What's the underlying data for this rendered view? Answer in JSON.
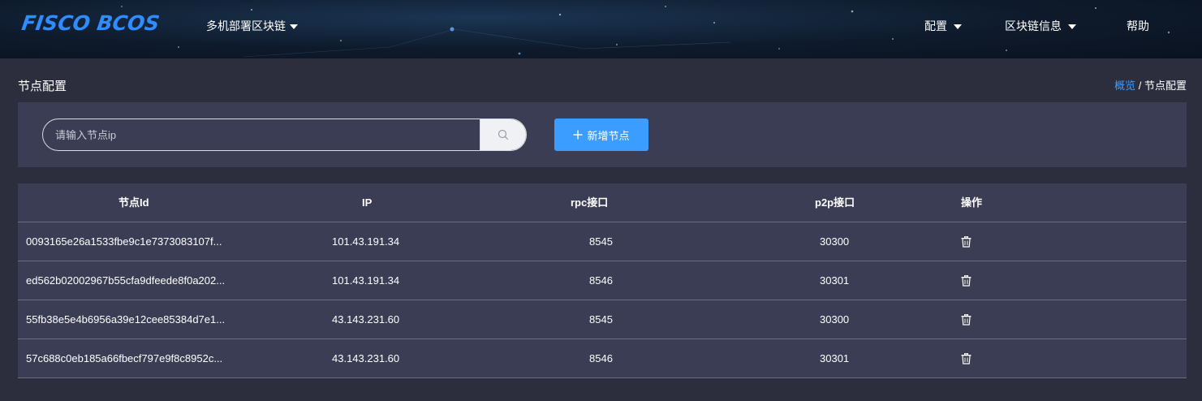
{
  "header": {
    "logo": "FISCO BCOS",
    "nav_left": [
      {
        "label": "多机部署区块链"
      }
    ],
    "nav_right": [
      {
        "label": "配置"
      },
      {
        "label": "区块链信息"
      },
      {
        "label": "帮助"
      }
    ]
  },
  "page": {
    "title": "节点配置",
    "breadcrumb": {
      "link": "概览",
      "separator": " / ",
      "current": "节点配置"
    }
  },
  "search": {
    "placeholder": "请输入节点ip",
    "value": "",
    "icon": "search-icon"
  },
  "add_button": {
    "icon": "plus-icon",
    "label": "新增节点"
  },
  "table": {
    "columns": [
      "节点Id",
      "IP",
      "rpc接口",
      "p2p接口",
      "操作"
    ],
    "rows": [
      {
        "node_id": "0093165e26a1533fbe9c1e7373083107f...",
        "ip": "101.43.191.34",
        "rpc": "8545",
        "p2p": "30300",
        "action_icon": "trash-icon"
      },
      {
        "node_id": "ed562b02002967b55cfa9dfeede8f0a202...",
        "ip": "101.43.191.34",
        "rpc": "8546",
        "p2p": "30301",
        "action_icon": "trash-icon"
      },
      {
        "node_id": "55fb38e5e4b6956a39e12cee85384d7e1...",
        "ip": "43.143.231.60",
        "rpc": "8545",
        "p2p": "30300",
        "action_icon": "trash-icon"
      },
      {
        "node_id": "57c688c0eb185a66fbecf797e9f8c8952c...",
        "ip": "43.143.231.60",
        "rpc": "8546",
        "p2p": "30301",
        "action_icon": "trash-icon"
      }
    ]
  },
  "colors": {
    "accent": "#3b9dff",
    "panel": "#3b3d54",
    "background": "#2c2e3d",
    "logo": "#2f8cff"
  }
}
